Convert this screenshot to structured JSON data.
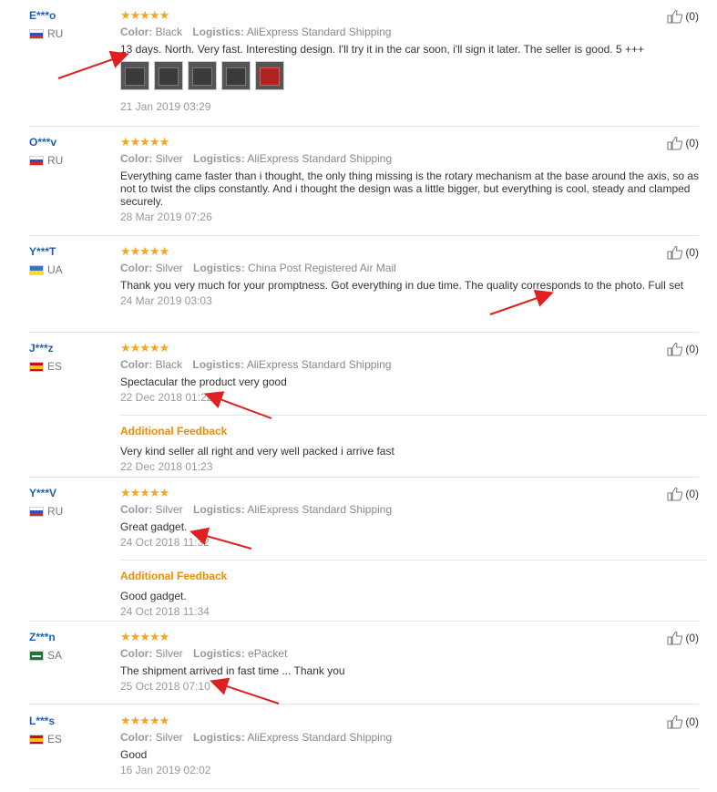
{
  "colors": {
    "username": "#1e5fb3",
    "stars": "#f5a623",
    "additional_feedback": "#f08c00",
    "annotation_arrow": "#e02020"
  },
  "labels": {
    "color": "Color:",
    "logistics": "Logistics:",
    "additional_feedback": "Additional Feedback",
    "stars": "★★★★★"
  },
  "reviews": [
    {
      "user": "E***o",
      "country": "RU",
      "color": "Black",
      "logistics": "AliExpress Standard Shipping",
      "text": "13 days. North. Very fast. Interesting design. I'll try it in the car soon, i'll sign it later. The seller is good. 5 +++",
      "photos": 5,
      "date": "21 Jan 2019 03:29",
      "helpful": "(0)"
    },
    {
      "user": "O***v",
      "country": "RU",
      "color": "Silver",
      "logistics": "AliExpress Standard Shipping",
      "text": "Everything came faster than i thought, the only thing missing is the rotary mechanism at the base around the axis, so as not to twist the clips constantly. And i thought the design was a little bigger, but everything is cool, steady and clamped securely.",
      "date": "28 Mar 2019 07:26",
      "helpful": "(0)"
    },
    {
      "user": "Y***T",
      "country": "UA",
      "color": "Silver",
      "logistics": "China Post Registered Air Mail",
      "text": "Thank you very much for your promptness. Got everything in due time. The quality corresponds to the photo. Full set",
      "date": "24 Mar 2019 03:03",
      "helpful": "(0)"
    },
    {
      "user": "J***z",
      "country": "ES",
      "color": "Black",
      "logistics": "AliExpress Standard Shipping",
      "text": "Spectacular the product very good",
      "date": "22 Dec 2018 01:22",
      "additional_text": "Very kind seller all right and very well packed i arrive fast",
      "additional_date": "22 Dec 2018 01:23",
      "helpful": "(0)"
    },
    {
      "user": "Y***V",
      "country": "RU",
      "color": "Silver",
      "logistics": "AliExpress Standard Shipping",
      "text": "Great gadget.",
      "date": "24 Oct 2018 11:32",
      "additional_text": "Good gadget.",
      "additional_date": "24 Oct 2018 11:34",
      "helpful": "(0)"
    },
    {
      "user": "Z***n",
      "country": "SA",
      "color": "Silver",
      "logistics": "ePacket",
      "text": "The shipment arrived in fast time ... Thank you",
      "date": "25 Oct 2018 07:10",
      "helpful": "(0)"
    },
    {
      "user": "L***s",
      "country": "ES",
      "color": "Silver",
      "logistics": "AliExpress Standard Shipping",
      "text": "Good",
      "date": "16 Jan 2019 02:02",
      "helpful": "(0)"
    }
  ]
}
